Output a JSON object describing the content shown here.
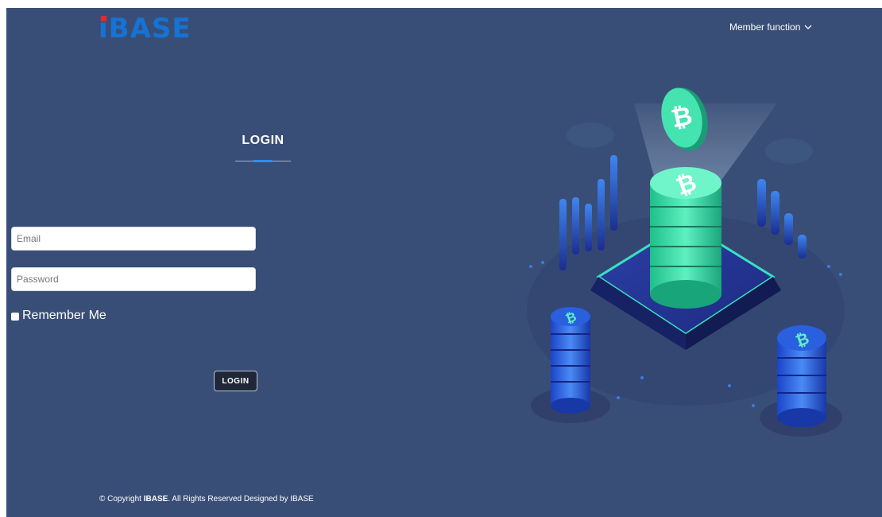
{
  "header": {
    "logo_text": "iBASE",
    "member_menu_label": "Member function"
  },
  "login": {
    "title": "LOGIN",
    "email_placeholder": "Email",
    "password_placeholder": "Password",
    "remember_label": "Remember Me",
    "submit_label": "LOGIN"
  },
  "footer": {
    "prefix": "© Copyright ",
    "brand": "IBASE",
    "suffix": ". All Rights Reserved Designed by IBASE"
  },
  "colors": {
    "background": "#394e77",
    "logo_blue": "#1573d6",
    "accent": "#2e8ff0",
    "coin_green": "#3fe6b0"
  },
  "icons": {
    "member_menu": "chevron-down-icon",
    "illustration": "crypto-coin-platform-illustration"
  }
}
